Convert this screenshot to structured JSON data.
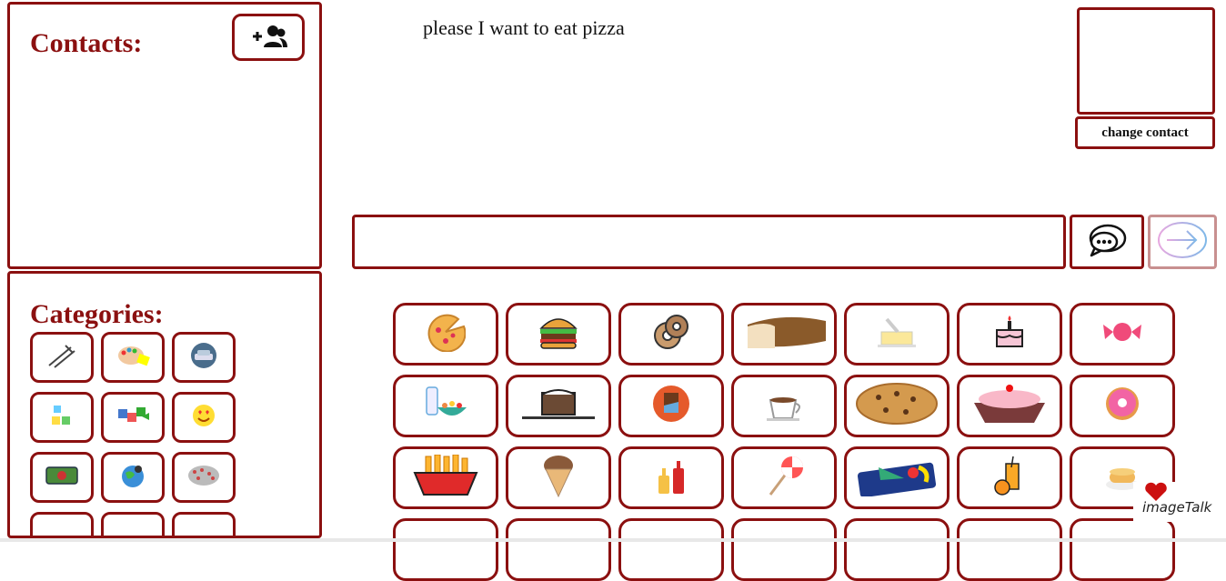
{
  "contacts": {
    "title": "Contacts:",
    "add_icon": "add-contact-icon"
  },
  "categories": {
    "title": "Categories:",
    "items": [
      {
        "icon": "fork-knife-icon"
      },
      {
        "icon": "art-palette-icon"
      },
      {
        "icon": "car-icon"
      },
      {
        "icon": "toy-blocks-icon"
      },
      {
        "icon": "puzzle-icon"
      },
      {
        "icon": "heart-eyes-emoji-icon"
      },
      {
        "icon": "money-bill-icon"
      },
      {
        "icon": "globe-location-icon"
      },
      {
        "icon": "crowd-icon"
      },
      {
        "icon": "more-category-1-icon"
      },
      {
        "icon": "more-category-2-icon"
      },
      {
        "icon": "more-category-3-icon"
      }
    ]
  },
  "message": {
    "text": "please I want to eat pizza"
  },
  "contact_card": {
    "change_label": "change contact"
  },
  "sentence_bar": {
    "value": ""
  },
  "actions": {
    "speak_icon": "speech-bubble-icon",
    "send_icon": "arrow-right-icon"
  },
  "words": [
    {
      "icon": "pizza-icon"
    },
    {
      "icon": "hamburger-icon"
    },
    {
      "icon": "bagel-icon"
    },
    {
      "icon": "bread-icon"
    },
    {
      "icon": "butter-icon"
    },
    {
      "icon": "birthday-cake-icon"
    },
    {
      "icon": "candy-icon"
    },
    {
      "icon": "cereal-milk-icon"
    },
    {
      "icon": "chocolate-cake-icon"
    },
    {
      "icon": "chocolate-bar-icon"
    },
    {
      "icon": "hot-chocolate-icon"
    },
    {
      "icon": "cookie-icon"
    },
    {
      "icon": "cupcake-dessert-icon"
    },
    {
      "icon": "donut-icon"
    },
    {
      "icon": "fries-icon"
    },
    {
      "icon": "ice-cream-cone-icon"
    },
    {
      "icon": "ketchup-mustard-icon"
    },
    {
      "icon": "lollipop-icon"
    },
    {
      "icon": "lunchbox-icon"
    },
    {
      "icon": "orange-juice-icon"
    },
    {
      "icon": "pancakes-icon"
    },
    {
      "icon": "more-food-1-icon"
    },
    {
      "icon": "more-food-2-icon"
    },
    {
      "icon": "more-food-3-icon"
    },
    {
      "icon": "more-food-4-icon"
    },
    {
      "icon": "more-food-5-icon"
    },
    {
      "icon": "more-food-6-icon"
    },
    {
      "icon": "more-food-7-icon"
    }
  ],
  "logo": {
    "text": "imageTalk",
    "color_heart": "#cc1010"
  },
  "colors": {
    "accent": "#8b1010",
    "send_border": "#c89090"
  }
}
